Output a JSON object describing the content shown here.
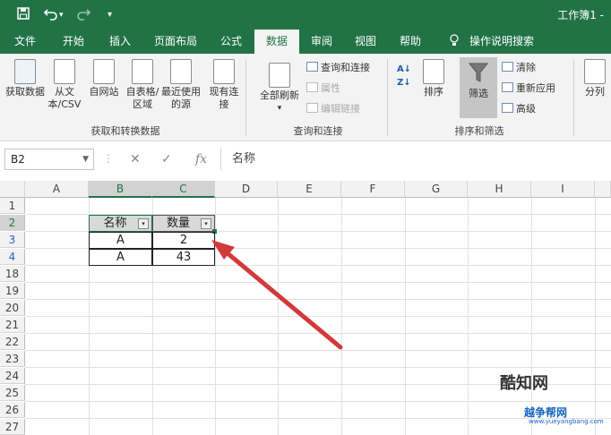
{
  "titlebar": {
    "title": "工作簿1 -",
    "save_icon": "save-icon",
    "undo_icon": "undo-icon",
    "redo_icon": "redo-icon",
    "customize": "▾"
  },
  "tabs": [
    "文件",
    "开始",
    "插入",
    "页面布局",
    "公式",
    "数据",
    "审阅",
    "视图",
    "帮助",
    "操作说明搜索"
  ],
  "active_tab": "数据",
  "ribbon": {
    "get_transform": {
      "buttons": [
        "获取数据",
        "从文本/CSV",
        "自网站",
        "自表格/区域",
        "最近使用的源",
        "现有连接"
      ],
      "label": "获取和转换数据"
    },
    "queries": {
      "refresh_all": "全部刷新",
      "items": [
        "查询和连接",
        "属性",
        "编辑链接"
      ],
      "label": "查询和连接"
    },
    "sort_filter": {
      "sort": "排序",
      "filter": "筛选",
      "items": [
        "清除",
        "重新应用",
        "高级"
      ],
      "label": "排序和筛选"
    },
    "split": "分列"
  },
  "formula_bar": {
    "name_box": "B2",
    "cancel": "✕",
    "enter": "✓",
    "fx": "fx",
    "formula": "名称"
  },
  "sheet": {
    "columns": [
      "A",
      "B",
      "C",
      "D",
      "E",
      "F",
      "G",
      "H",
      "I"
    ],
    "rows": [
      "1",
      "2",
      "3",
      "4",
      "18",
      "19",
      "20",
      "21",
      "22",
      "23",
      "24",
      "25",
      "26",
      "27"
    ],
    "table_header": [
      "名称",
      "数量"
    ],
    "table_rows": [
      [
        "A",
        "2"
      ],
      [
        "A",
        "43"
      ]
    ]
  },
  "watermark": {
    "line1": "酷知网",
    "line2": "越争帮网",
    "line3": "www.yueyangbang.com"
  },
  "colors": {
    "brand": "#217346",
    "arrow": "#d23a3a"
  }
}
